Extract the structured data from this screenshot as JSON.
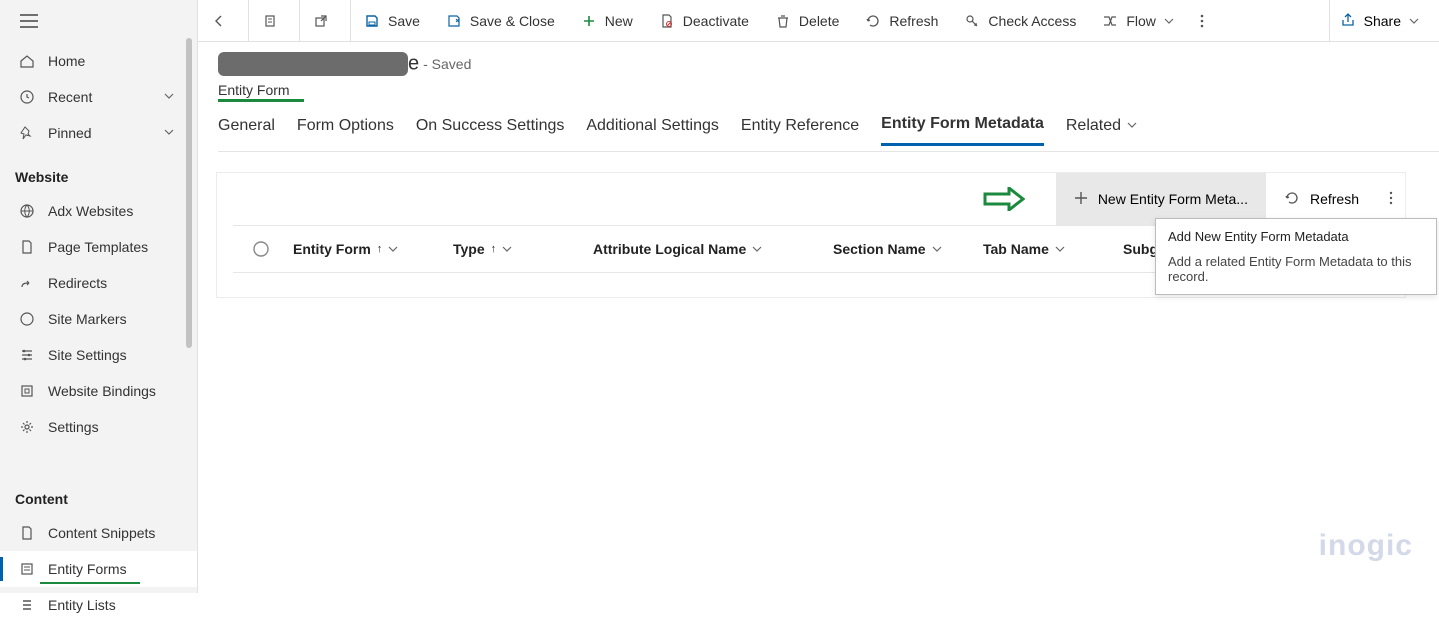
{
  "sidebar": {
    "home": "Home",
    "recent": "Recent",
    "pinned": "Pinned",
    "section1": "Website",
    "adx": "Adx Websites",
    "page_templates": "Page Templates",
    "redirects": "Redirects",
    "site_markers": "Site Markers",
    "site_settings": "Site Settings",
    "website_bindings": "Website Bindings",
    "settings": "Settings",
    "section2": "Content",
    "content_snippets": "Content Snippets",
    "entity_forms": "Entity Forms",
    "entity_lists": "Entity Lists"
  },
  "cmdbar": {
    "save": "Save",
    "save_close": "Save & Close",
    "new": "New",
    "deactivate": "Deactivate",
    "delete": "Delete",
    "refresh": "Refresh",
    "check_access": "Check Access",
    "flow": "Flow",
    "share": "Share"
  },
  "header": {
    "title_suffix": "e",
    "saved": " - Saved",
    "subtitle": "Entity Form"
  },
  "tabs": {
    "general": "General",
    "form_options": "Form Options",
    "on_success": "On Success Settings",
    "additional": "Additional Settings",
    "entity_ref": "Entity Reference",
    "entity_form_meta": "Entity Form Metadata",
    "related": "Related"
  },
  "grid_cmd": {
    "new_meta": "New Entity Form Meta...",
    "refresh": "Refresh"
  },
  "columns": {
    "entity_form": "Entity Form",
    "type": "Type",
    "attr": "Attribute Logical Name",
    "section": "Section Name",
    "tab": "Tab Name",
    "subgrid": "Subgrid"
  },
  "tooltip": {
    "title": "Add New Entity Form Metadata",
    "desc": "Add a related Entity Form Metadata to this record."
  },
  "watermark": "inogic"
}
